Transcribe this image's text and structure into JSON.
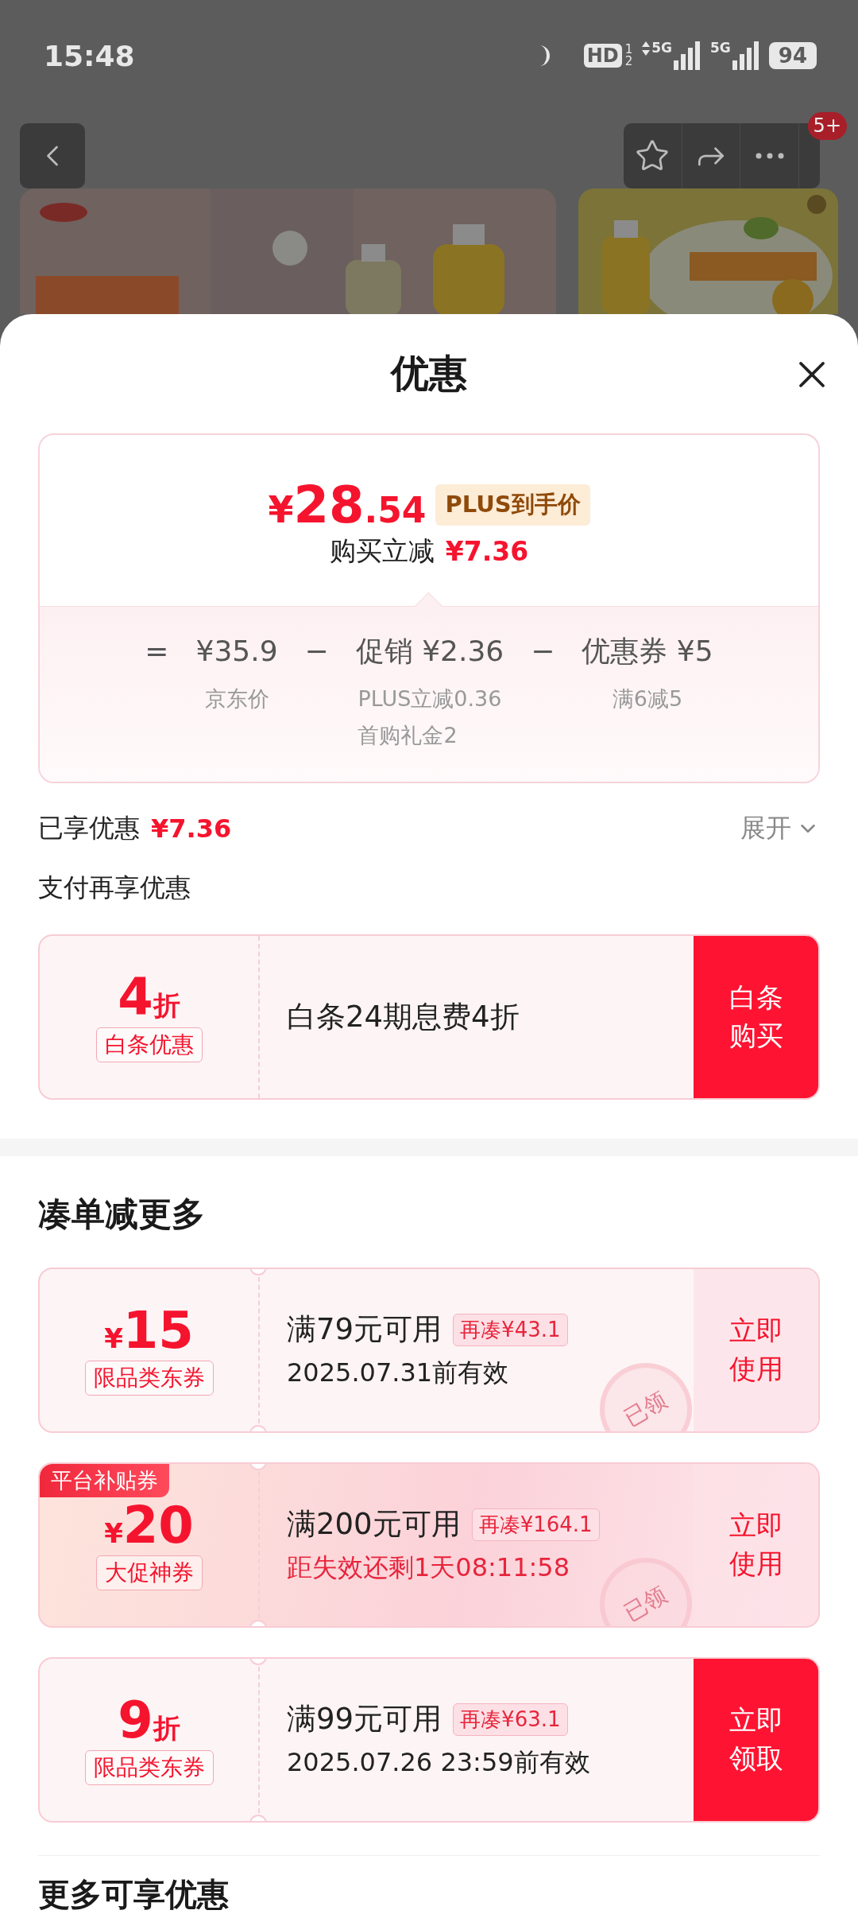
{
  "status_bar": {
    "time": "15:48",
    "hd": "HD",
    "hd_slots": [
      "1",
      "2"
    ],
    "networks": [
      {
        "label": "5G",
        "data_active": true
      },
      {
        "label": "5G",
        "data_active": false
      }
    ],
    "battery": "94"
  },
  "nav": {
    "badge": "5+"
  },
  "sheet": {
    "title": "优惠",
    "price_card": {
      "price": {
        "currency": "¥",
        "integer": "28",
        "decimal": ".54"
      },
      "price_badge": "PLUS到手价",
      "saving_label": "购买立减",
      "saving": "¥7.36",
      "breakdown": [
        {
          "operator": "=",
          "amount": "¥35.9",
          "notes": [
            "京东价"
          ]
        },
        {
          "operator": "−",
          "amount": "促销 ¥2.36",
          "notes": [
            "PLUS立减0.36",
            "首购礼金2"
          ]
        },
        {
          "operator": "−",
          "amount": "优惠券 ¥5",
          "notes": [
            "满6减5"
          ]
        }
      ]
    },
    "enjoyed": {
      "label": "已享优惠",
      "amount": "¥7.36",
      "toggle": "展开",
      "expanded": false
    },
    "pay_title": "支付再享优惠",
    "pay_offer": {
      "value": "4",
      "unit": "折",
      "tag": "白条优惠",
      "description": "白条24期息费4折",
      "button": "白条购买"
    },
    "bundle_title": "凑单减更多",
    "coupons": [
      {
        "amount": {
          "prefix": "¥",
          "value": "15"
        },
        "tag": "限品类东券",
        "condition": "满79元可用",
        "gap": "再凑¥43.1",
        "validity": "2025.07.31前有效",
        "validity_urgent": false,
        "button": "立即使用",
        "button_filled": false,
        "stamp": "已领",
        "highlight": false
      },
      {
        "ribbon": "平台补贴券",
        "amount": {
          "prefix": "¥",
          "value": "20"
        },
        "tag": "大促神券",
        "condition": "满200元可用",
        "gap": "再凑¥164.1",
        "validity": "距失效还剩1天08:11:58",
        "validity_urgent": true,
        "button": "立即使用",
        "button_filled": false,
        "stamp": "已领",
        "highlight": true
      },
      {
        "amount": {
          "value": "9",
          "suffix": "折"
        },
        "tag": "限品类东券",
        "condition": "满99元可用",
        "gap": "再凑¥63.1",
        "validity": "2025.07.26 23:59前有效",
        "validity_urgent": false,
        "button": "立即领取",
        "button_filled": true,
        "highlight": false
      }
    ],
    "more_title": "更多可享优惠"
  }
}
